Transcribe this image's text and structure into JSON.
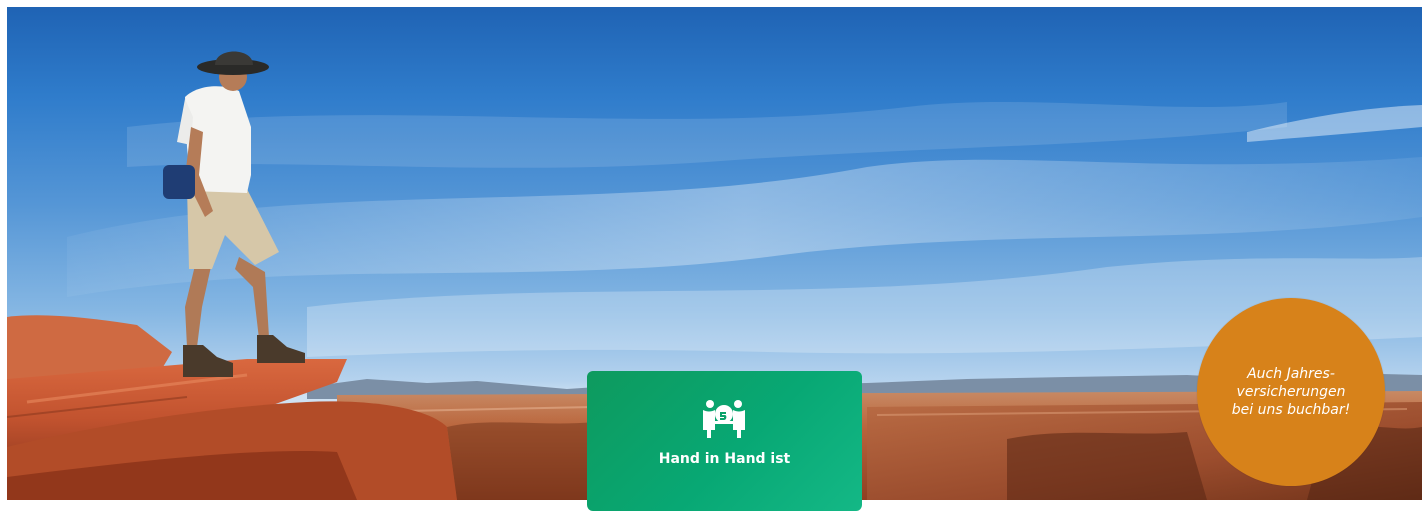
{
  "badge": {
    "text": "Auch Jahres-\nversicherungen\nbei uns buchbar!",
    "color": "#d7821a"
  },
  "card": {
    "title": "Hand in Hand ist",
    "icon": "hand-in-hand-icon",
    "color": "#0aa26a"
  },
  "hero": {
    "scene": "hiker-on-canyon-rock-icon"
  }
}
